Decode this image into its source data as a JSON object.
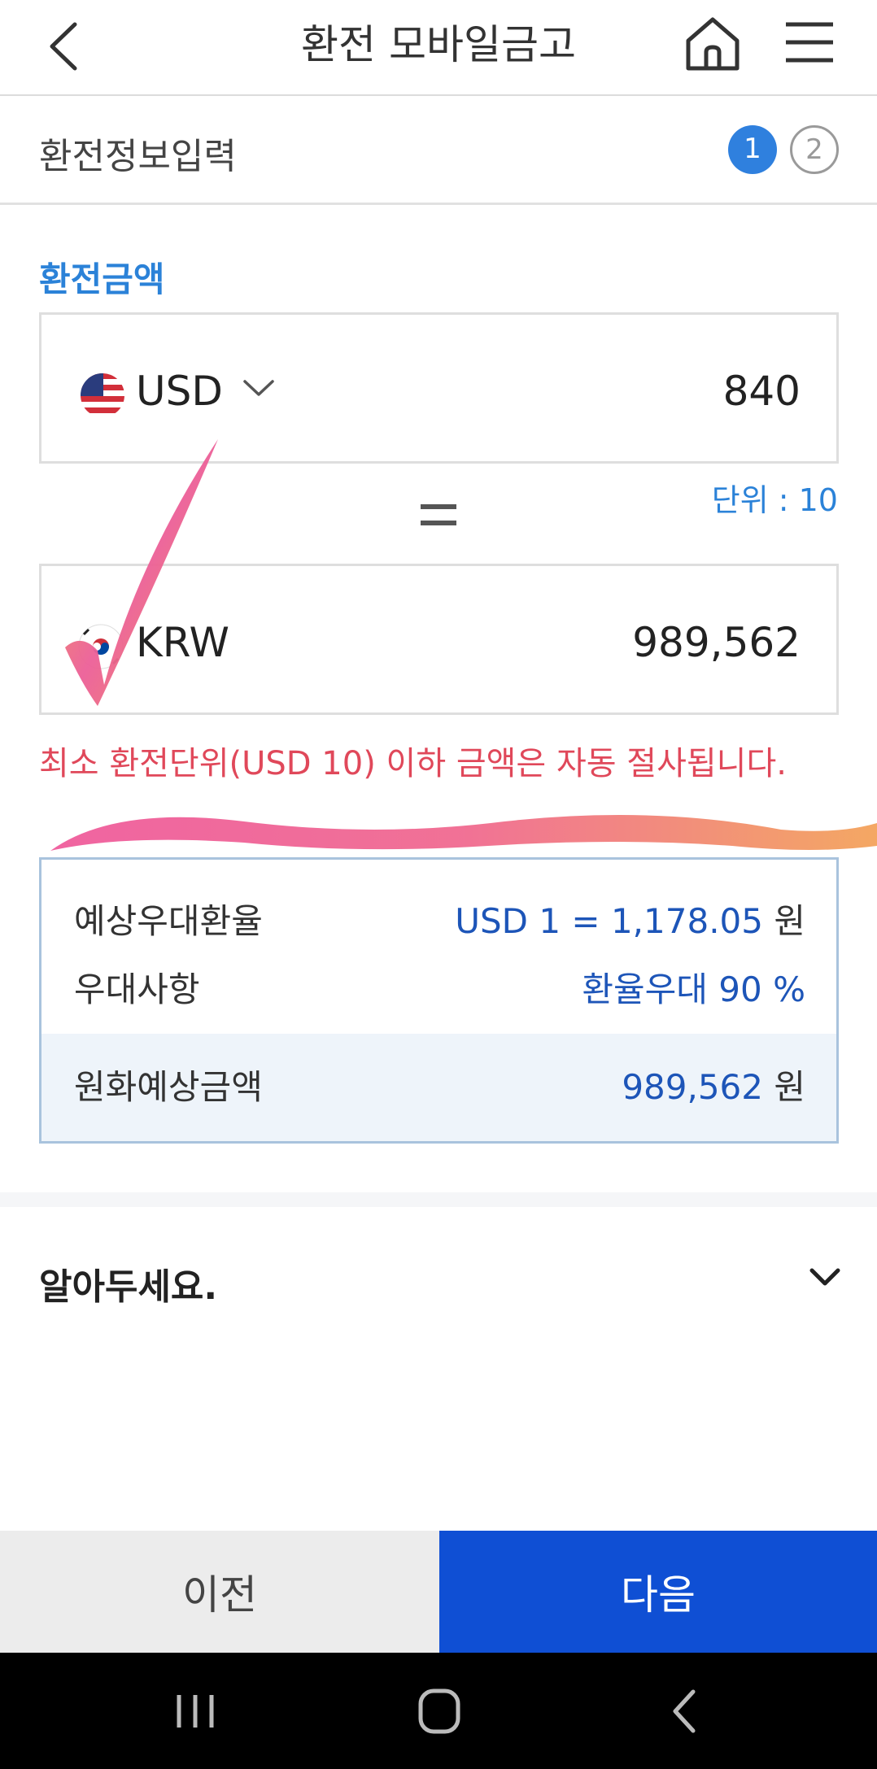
{
  "header": {
    "title": "환전 모바일금고",
    "back_icon": "chevron-left-icon",
    "home_icon": "home-icon",
    "menu_icon": "hamburger-menu-icon"
  },
  "steps": {
    "label": "환전정보입력",
    "items": [
      "1",
      "2"
    ],
    "current": 1
  },
  "exchange": {
    "section_label": "환전금액",
    "from": {
      "currency": "USD",
      "amount": "840",
      "flag": "us-flag-icon"
    },
    "unit_note": "단위 : 10",
    "to": {
      "currency": "KRW",
      "amount": "989,562",
      "flag": "kr-flag-icon"
    },
    "warning": "최소 환전단위(USD 10) 이하 금액은 자동 절사됩니다."
  },
  "summary": {
    "rate_label": "예상우대환율",
    "rate_value": "USD 1 = 1,178.05",
    "rate_suffix": "원",
    "benefit_label": "우대사항",
    "benefit_value": "환율우대 90 %",
    "total_label": "원화예상금액",
    "total_value": "989,562",
    "total_suffix": "원"
  },
  "notice": {
    "label": "알아두세요."
  },
  "buttons": {
    "prev": "이전",
    "next": "다음"
  },
  "colors": {
    "accent": "#2b82d8",
    "primary_button": "#0f4fd4",
    "warning": "#e0485a",
    "highlight_value": "#1d55b8"
  }
}
